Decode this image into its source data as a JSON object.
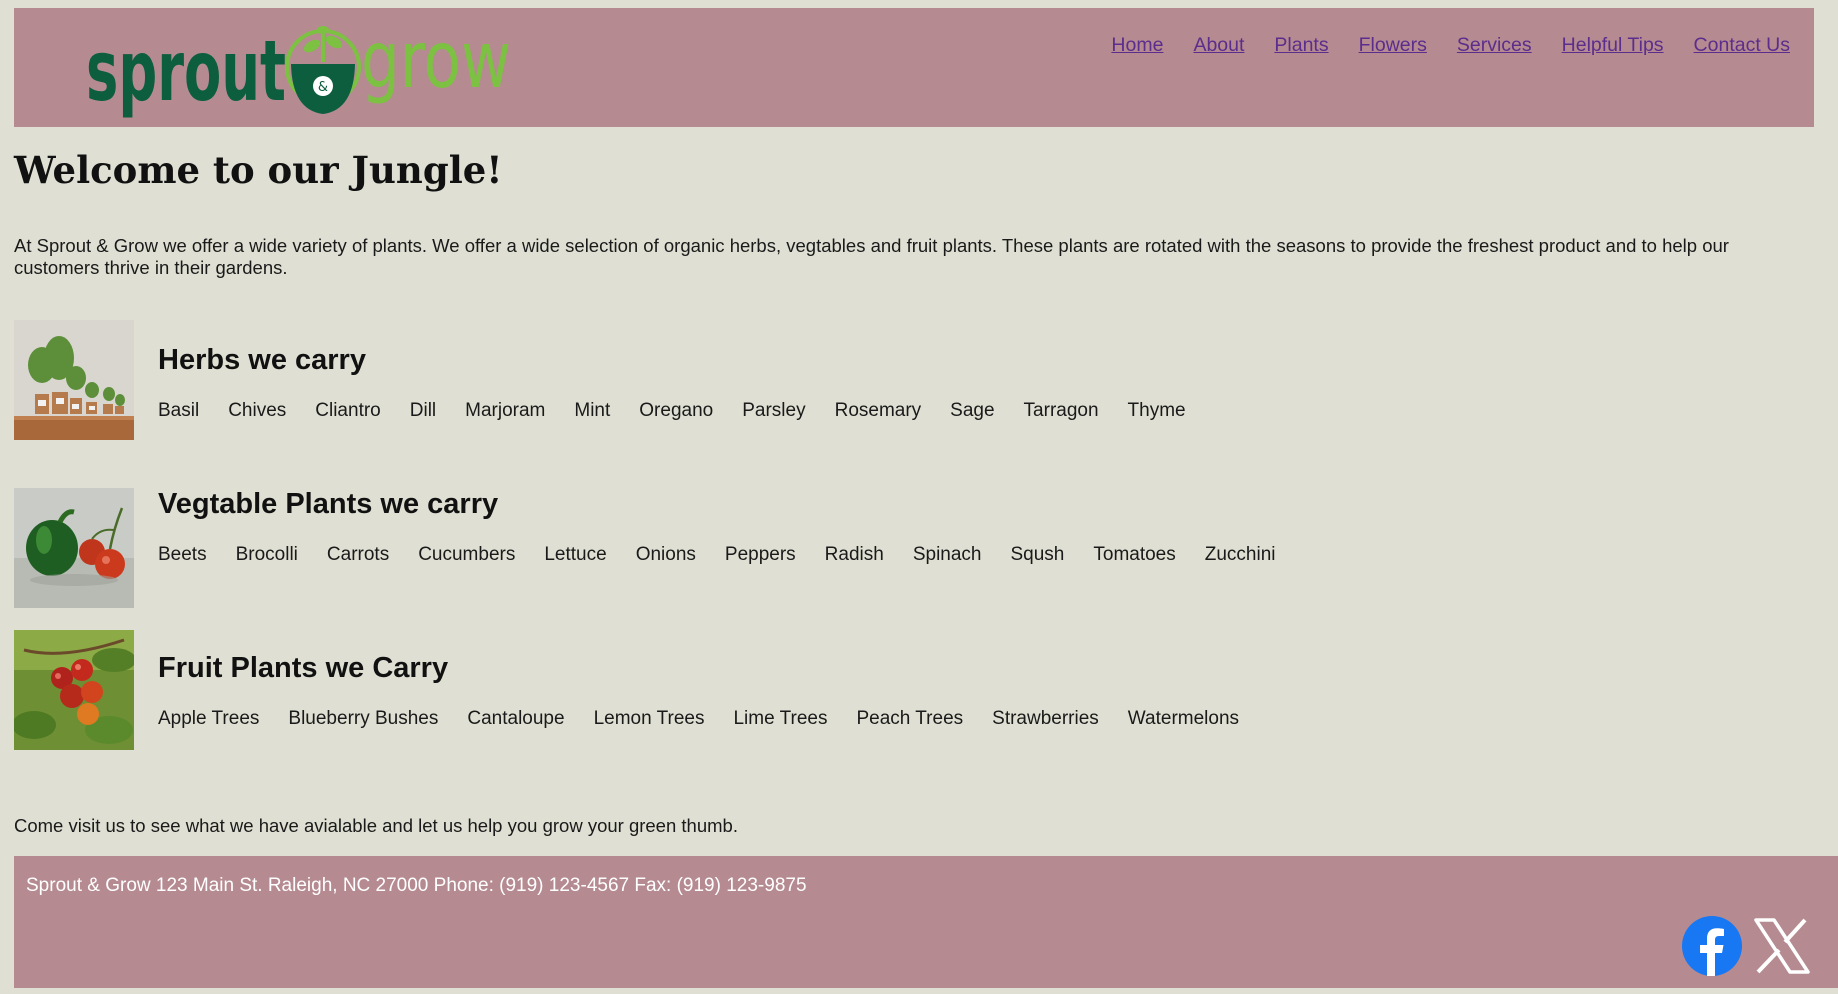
{
  "header": {
    "logo": {
      "word1": "sprout",
      "ampersand": "&",
      "word2": "grow",
      "colors": {
        "dark": "#0d5e3e",
        "light": "#7cc142"
      }
    },
    "nav": [
      {
        "label": "Home"
      },
      {
        "label": "About"
      },
      {
        "label": "Plants"
      },
      {
        "label": "Flowers"
      },
      {
        "label": "Services"
      },
      {
        "label": "Helpful Tips"
      },
      {
        "label": "Contact Us"
      }
    ]
  },
  "main": {
    "title": "Welcome to our Jungle!",
    "intro": "At Sprout & Grow we offer a wide variety of plants. We offer a wide selection of organic herbs, vegtables and fruit plants. These plants are rotated with the seasons to provide the freshest product and to help our customers thrive in their gardens.",
    "sections": [
      {
        "heading": "Herbs we carry",
        "image": "potted-herbs-photo",
        "items": [
          "Basil",
          "Chives",
          "Cliantro",
          "Dill",
          "Marjoram",
          "Mint",
          "Oregano",
          "Parsley",
          "Rosemary",
          "Sage",
          "Tarragon",
          "Thyme"
        ]
      },
      {
        "heading": "Vegtable Plants we carry",
        "image": "pepper-and-tomatoes-photo",
        "items": [
          "Beets",
          "Brocolli",
          "Carrots",
          "Cucumbers",
          "Lettuce",
          "Onions",
          "Peppers",
          "Radish",
          "Spinach",
          "Sqush",
          "Tomatoes",
          "Zucchini"
        ]
      },
      {
        "heading": "Fruit Plants we Carry",
        "image": "fruit-on-branch-photo",
        "items": [
          "Apple Trees",
          "Blueberry Bushes",
          "Cantaloupe",
          "Lemon Trees",
          "Lime Trees",
          "Peach Trees",
          "Strawberries",
          "Watermelons"
        ]
      }
    ],
    "closing": "Come visit us to see what we have avialable and let us help you grow your green thumb."
  },
  "footer": {
    "text": "Sprout & Grow 123 Main St. Raleigh, NC 27000 Phone: (919) 123-4567 Fax: (919) 123-9875",
    "social": [
      {
        "icon": "facebook-icon",
        "color": "#1877f2"
      },
      {
        "icon": "x-icon",
        "color": "#ffffff"
      }
    ]
  },
  "colors": {
    "background": "#dfe0d3",
    "header_footer": "#b58b91",
    "link": "#5b2d8c"
  }
}
